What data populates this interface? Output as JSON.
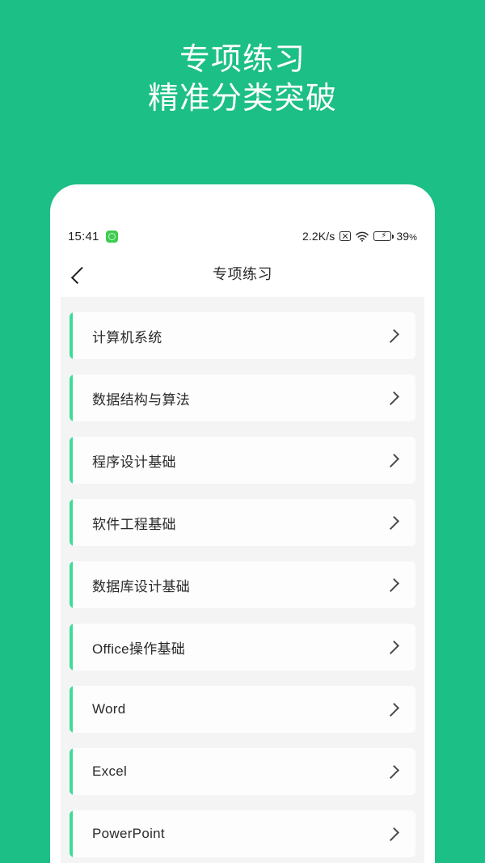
{
  "promo": {
    "headline_line1": "专项练习",
    "headline_line2": "精准分类突破",
    "background_color": "#1cbf85"
  },
  "status_bar": {
    "time": "15:41",
    "app_badge_icon": "app-badge-icon",
    "network_speed": "2.2K/s",
    "mute_icon": "boxed-x-icon",
    "wifi_icon": "wifi-icon",
    "battery_icon": "battery-charging-icon",
    "battery_percent": "39",
    "percent_sign": "%"
  },
  "nav": {
    "back_icon": "chevron-left-icon",
    "title": "专项练习"
  },
  "list": {
    "chevron_icon": "chevron-right-icon",
    "accent_color": "#3edc98",
    "items": [
      {
        "label": "计算机系统"
      },
      {
        "label": "数据结构与算法"
      },
      {
        "label": "程序设计基础"
      },
      {
        "label": "软件工程基础"
      },
      {
        "label": "数据库设计基础"
      },
      {
        "label": "Office操作基础"
      },
      {
        "label": "Word"
      },
      {
        "label": "Excel"
      },
      {
        "label": "PowerPoint"
      }
    ]
  }
}
